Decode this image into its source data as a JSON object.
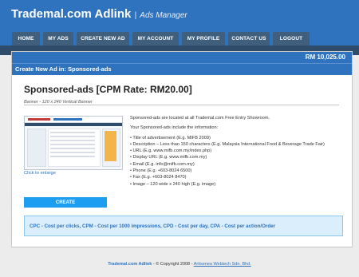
{
  "header": {
    "brand": "Trademal.com Adlink",
    "subtitle": "Ads Manager",
    "separator": "|"
  },
  "nav": {
    "items": [
      {
        "label": "HOME"
      },
      {
        "label": "MY ADS"
      },
      {
        "label": "CREATE NEW AD"
      },
      {
        "label": "MY ACCOUNT"
      },
      {
        "label": "MY PROFILE"
      },
      {
        "label": "CONTACT US"
      },
      {
        "label": "LOGOUT"
      }
    ]
  },
  "account": {
    "balance": "RM 10,025.00"
  },
  "page": {
    "title": "Create New Ad in: Sponsored-ads"
  },
  "ad": {
    "heading": "Sponsored-ads [CPM Rate: RM20.00]",
    "banner_spec": "Banner - 120 x 240 Vertical Banner",
    "click_to_enlarge": "Click to enlarge",
    "intro_1": "Sponsored-ads are located at all Trademal.com Free Entry Showroom.",
    "intro_2": "Your Sponsored-ads include the information:",
    "bullets": [
      "• Title of advertisement (E.g. MIFB 2009)",
      "• Description – Less than 150 characters (E.g. Malaysia International Food & Beverage Trade Fair)",
      "• URL (E.g. www.mifb.com.my/index.php)",
      "• Display URL (E.g. www.mifb.com.my)",
      "• Email (E.g. info@mifb.com.my)",
      "• Phone (E.g. +603-8024 6500)",
      "• Fax (E.g. +603-8024 8470)",
      "• Image – 120 wide x 240 high (E.g. image)"
    ],
    "create_label": "CREATE"
  },
  "legend": {
    "text": "CPC - Cost per clicks, CPM - Cost per 1000 impressions, CPD - Cost per day, CPA - Cost per action/Order"
  },
  "footer": {
    "brand": "Trademal.com Adlink",
    "copyright": " - © Copyright 2008 - ",
    "company": "Artisenea Webtech Sdn. Bhd."
  },
  "colors": {
    "primary": "#2f72bd",
    "nav_button": "#3f5f7d",
    "create_button": "#1e9ef0",
    "legend_bg": "#dbeefb"
  }
}
